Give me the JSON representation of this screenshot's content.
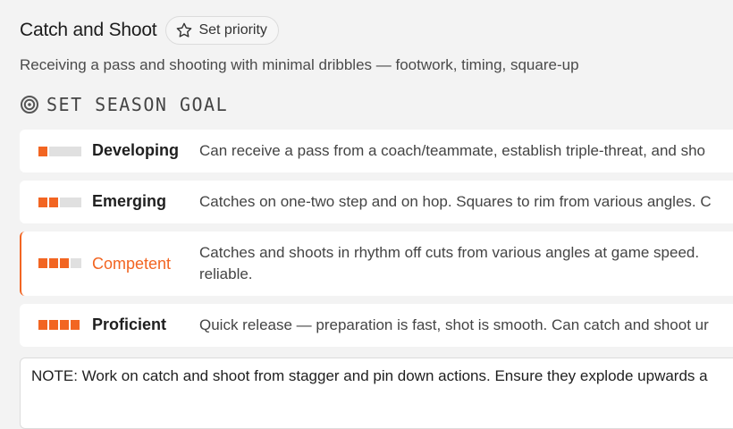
{
  "header": {
    "title": "Catch and Shoot",
    "priority_label": "Set priority"
  },
  "subtitle": "Receiving a pass and shooting with minimal dribbles — footwork, timing, square-up",
  "goal": {
    "label": "SET SEASON GOAL"
  },
  "levels": [
    {
      "name": "Developing",
      "filled": 1,
      "total": 4,
      "desc": "Can receive a pass from a coach/teammate, establish triple-threat, and sho"
    },
    {
      "name": "Emerging",
      "filled": 2,
      "total": 4,
      "desc": "Catches on one-two step and on hop. Squares to rim from various angles. C"
    },
    {
      "name": "Competent",
      "filled": 3,
      "total": 4,
      "desc": "Catches and shoots in rhythm off cuts from various angles at game speed.",
      "desc2": "reliable."
    },
    {
      "name": "Proficient",
      "filled": 4,
      "total": 4,
      "desc": "Quick release — preparation is fast, shot is smooth. Can catch and shoot ur"
    }
  ],
  "selected_level": "Competent",
  "note": {
    "text": "NOTE: Work on catch and shoot from stagger and pin down actions. Ensure they explode upwards a"
  },
  "colors": {
    "accent": "#f26522",
    "bar_empty": "#e0e0e0",
    "background": "#f3f3f3"
  },
  "icons": {
    "priority": "star-outline-icon",
    "goal": "target-icon"
  }
}
